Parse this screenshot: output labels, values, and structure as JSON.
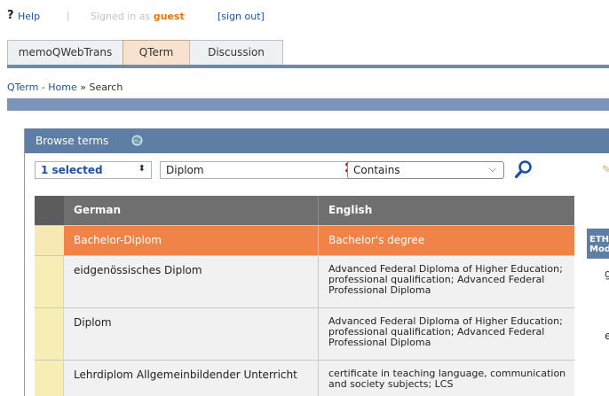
{
  "topbar": {
    "help_mark": "?",
    "help_label": "Help",
    "separator": "|",
    "signed_in_prefix": "Signed in as",
    "user": "guest",
    "signout_label": "[sign out]"
  },
  "tabs": [
    {
      "label": "memoQWebTrans"
    },
    {
      "label": "QTerm"
    },
    {
      "label": "Discussion"
    }
  ],
  "breadcrumb": {
    "home": "QTerm - Home",
    "separator": "»",
    "current": "Search"
  },
  "panel": {
    "title": "Browse terms"
  },
  "controls": {
    "language_select": "1 selected",
    "search_value": "Diplom",
    "match_mode": "Contains"
  },
  "table": {
    "headers": [
      "German",
      "English"
    ],
    "rows": [
      {
        "de": "Bachelor-Diplom",
        "en": "Bachelor's degree"
      },
      {
        "de": "eidgenössisches Diplom",
        "en": "Advanced Federal Diploma of Higher Education; professional qualification; Advanced Federal Professional Diploma"
      },
      {
        "de": "Diplom",
        "en": "Advanced Federal Diploma of Higher Education; professional qualification; Advanced Federal Professional Diploma"
      },
      {
        "de": "Lehrdiplom Allgemeinbildender Unterricht",
        "en": "certificate in teaching language, communication and society subjects; LCS"
      }
    ]
  },
  "right_panel": {
    "header_line1": "ETH",
    "header_line2": "Mod",
    "letters": [
      "g",
      "e"
    ]
  },
  "colors": {
    "accent_selected_row": "#f08348",
    "panel_header": "#5f7ea6",
    "table_header": "#6f6f6f",
    "link": "#1e50a8"
  }
}
